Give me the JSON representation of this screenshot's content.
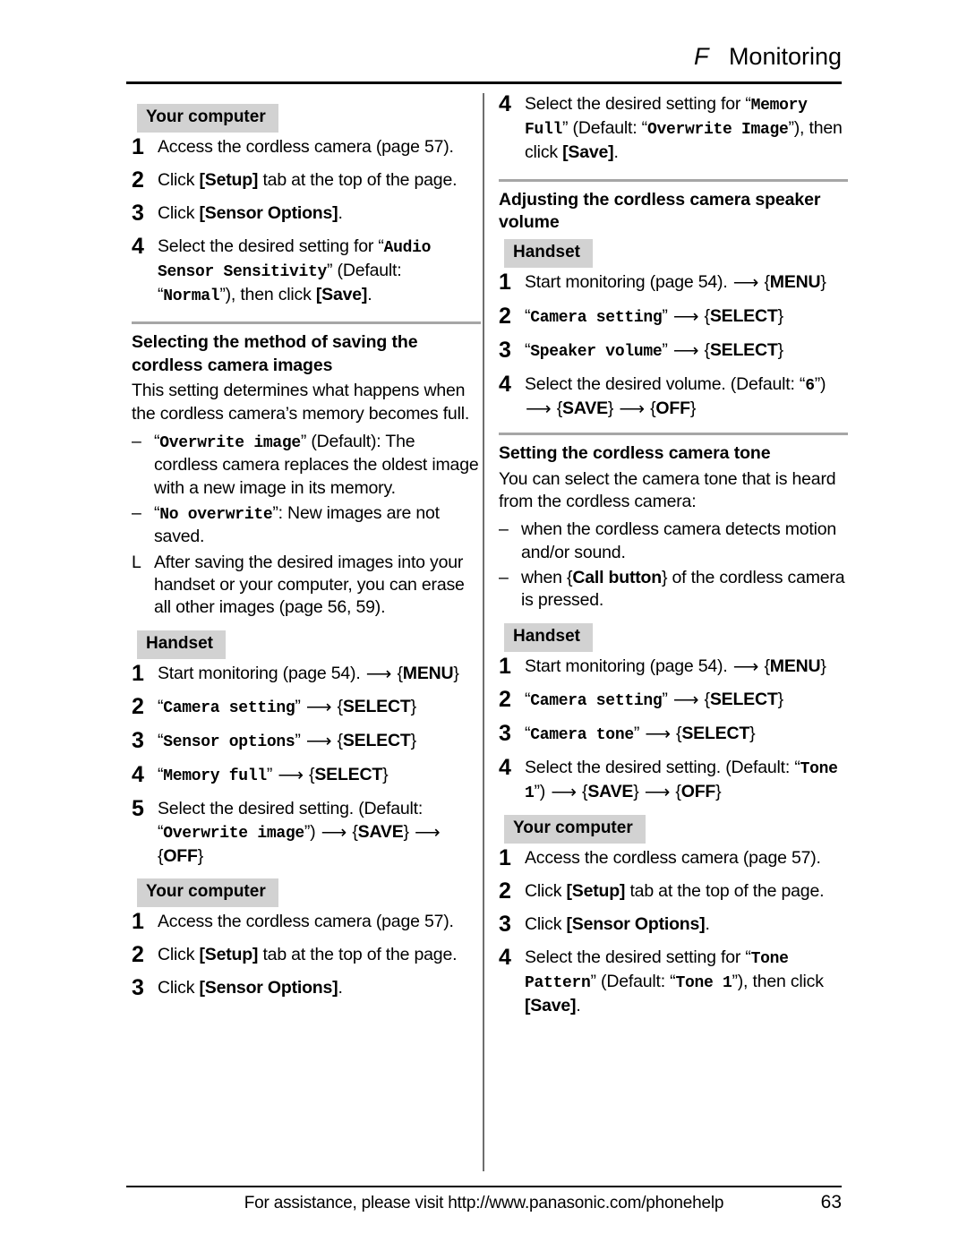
{
  "header": {
    "mark": "F",
    "title": "Monitoring"
  },
  "footer": {
    "assistance_text": "For assistance, please visit http://www.panasonic.com/phonehelp",
    "page_number": "63"
  },
  "labels": {
    "your_computer": "Your computer",
    "handset": "Handset"
  },
  "left_column": {
    "audio_sensor_computer_steps": [
      {
        "num": "1",
        "text": "Access the cordless camera (page 57)."
      },
      {
        "num": "2",
        "prefix": "Click ",
        "key": "[Setup]",
        "suffix": " tab at the top of the page."
      },
      {
        "num": "3",
        "prefix": "Click ",
        "key": "[Sensor Options]",
        "suffix": "."
      },
      {
        "num": "4",
        "parts": [
          {
            "t": "Select the desired setting for “",
            "s": "plain"
          },
          {
            "t": "Audio Sensor Sensitivity",
            "s": "mono"
          },
          {
            "t": "” (Default: “",
            "s": "plain"
          },
          {
            "t": "Normal",
            "s": "mono"
          },
          {
            "t": "”), then click ",
            "s": "plain"
          },
          {
            "t": "[Save]",
            "s": "bold"
          },
          {
            "t": ".",
            "s": "plain"
          }
        ]
      }
    ],
    "saving_section": {
      "title": "Selecting the method of saving the cordless camera images",
      "intro": "This setting determines what happens when the cordless camera’s memory becomes full.",
      "bullets": [
        {
          "marker": "–",
          "parts": [
            {
              "t": "“",
              "s": "plain"
            },
            {
              "t": "Overwrite image",
              "s": "mono"
            },
            {
              "t": "” (Default): The cordless camera replaces the oldest image with a new image in its memory.",
              "s": "plain"
            }
          ]
        },
        {
          "marker": "–",
          "parts": [
            {
              "t": "“",
              "s": "plain"
            },
            {
              "t": "No overwrite",
              "s": "mono"
            },
            {
              "t": "”: New images are not saved.",
              "s": "plain"
            }
          ]
        },
        {
          "marker": "L",
          "parts": [
            {
              "t": "After saving the desired images into your handset or your computer, you can erase all other images (page 56, 59).",
              "s": "plain"
            }
          ]
        }
      ],
      "handset_steps": [
        {
          "num": "1",
          "parts": [
            {
              "t": "Start monitoring (page 54). ",
              "s": "plain"
            },
            {
              "t": "⟶",
              "s": "arrow"
            },
            {
              "t": " {",
              "s": "brace"
            },
            {
              "t": "MENU",
              "s": "key"
            },
            {
              "t": "}",
              "s": "brace"
            }
          ]
        },
        {
          "num": "2",
          "parts": [
            {
              "t": "“",
              "s": "plain"
            },
            {
              "t": "Camera setting",
              "s": "mono"
            },
            {
              "t": "” ",
              "s": "plain"
            },
            {
              "t": "⟶",
              "s": "arrow"
            },
            {
              "t": " {",
              "s": "brace"
            },
            {
              "t": "SELECT",
              "s": "key"
            },
            {
              "t": "}",
              "s": "brace"
            }
          ]
        },
        {
          "num": "3",
          "parts": [
            {
              "t": "“",
              "s": "plain"
            },
            {
              "t": "Sensor options",
              "s": "mono"
            },
            {
              "t": "” ",
              "s": "plain"
            },
            {
              "t": "⟶",
              "s": "arrow"
            },
            {
              "t": " {",
              "s": "brace"
            },
            {
              "t": "SELECT",
              "s": "key"
            },
            {
              "t": "}",
              "s": "brace"
            }
          ]
        },
        {
          "num": "4",
          "parts": [
            {
              "t": "“",
              "s": "plain"
            },
            {
              "t": "Memory full",
              "s": "mono"
            },
            {
              "t": "” ",
              "s": "plain"
            },
            {
              "t": "⟶",
              "s": "arrow"
            },
            {
              "t": " {",
              "s": "brace"
            },
            {
              "t": "SELECT",
              "s": "key"
            },
            {
              "t": "}",
              "s": "brace"
            }
          ]
        },
        {
          "num": "5",
          "parts": [
            {
              "t": "Select the desired setting. (Default: “",
              "s": "plain"
            },
            {
              "t": "Overwrite image",
              "s": "mono"
            },
            {
              "t": "”) ",
              "s": "plain"
            },
            {
              "t": "⟶",
              "s": "arrow"
            },
            {
              "t": " {",
              "s": "brace"
            },
            {
              "t": "SAVE",
              "s": "key"
            },
            {
              "t": "} ",
              "s": "brace"
            },
            {
              "t": "⟶",
              "s": "arrow"
            },
            {
              "t": " {",
              "s": "brace"
            },
            {
              "t": "OFF",
              "s": "key"
            },
            {
              "t": "}",
              "s": "brace"
            }
          ]
        }
      ],
      "computer_steps": [
        {
          "num": "1",
          "text": "Access the cordless camera (page 57)."
        },
        {
          "num": "2",
          "prefix": "Click ",
          "key": "[Setup]",
          "suffix": " tab at the top of the page."
        },
        {
          "num": "3",
          "prefix": "Click ",
          "key": "[Sensor Options]",
          "suffix": "."
        }
      ]
    }
  },
  "right_column": {
    "memory_full_step": {
      "num": "4",
      "parts": [
        {
          "t": "Select the desired setting for “",
          "s": "plain"
        },
        {
          "t": "Memory Full",
          "s": "mono"
        },
        {
          "t": "” (Default: “",
          "s": "plain"
        },
        {
          "t": "Overwrite Image",
          "s": "mono"
        },
        {
          "t": "”), then click ",
          "s": "plain"
        },
        {
          "t": "[Save]",
          "s": "bold"
        },
        {
          "t": ".",
          "s": "plain"
        }
      ]
    },
    "speaker_section": {
      "title": "Adjusting the cordless camera speaker volume",
      "handset_steps": [
        {
          "num": "1",
          "parts": [
            {
              "t": "Start monitoring (page 54). ",
              "s": "plain"
            },
            {
              "t": "⟶",
              "s": "arrow"
            },
            {
              "t": " {",
              "s": "brace"
            },
            {
              "t": "MENU",
              "s": "key"
            },
            {
              "t": "}",
              "s": "brace"
            }
          ]
        },
        {
          "num": "2",
          "parts": [
            {
              "t": "“",
              "s": "plain"
            },
            {
              "t": "Camera setting",
              "s": "mono"
            },
            {
              "t": "” ",
              "s": "plain"
            },
            {
              "t": "⟶",
              "s": "arrow"
            },
            {
              "t": " {",
              "s": "brace"
            },
            {
              "t": "SELECT",
              "s": "key"
            },
            {
              "t": "}",
              "s": "brace"
            }
          ]
        },
        {
          "num": "3",
          "parts": [
            {
              "t": "“",
              "s": "plain"
            },
            {
              "t": "Speaker volume",
              "s": "mono"
            },
            {
              "t": "” ",
              "s": "plain"
            },
            {
              "t": "⟶",
              "s": "arrow"
            },
            {
              "t": " {",
              "s": "brace"
            },
            {
              "t": "SELECT",
              "s": "key"
            },
            {
              "t": "}",
              "s": "brace"
            }
          ]
        },
        {
          "num": "4",
          "parts": [
            {
              "t": "Select the desired volume. (Default: “",
              "s": "plain"
            },
            {
              "t": "6",
              "s": "mono"
            },
            {
              "t": "”) ",
              "s": "plain"
            },
            {
              "t": "⟶",
              "s": "arrow"
            },
            {
              "t": " {",
              "s": "brace"
            },
            {
              "t": "SAVE",
              "s": "key"
            },
            {
              "t": "} ",
              "s": "brace"
            },
            {
              "t": "⟶",
              "s": "arrow"
            },
            {
              "t": " {",
              "s": "brace"
            },
            {
              "t": "OFF",
              "s": "key"
            },
            {
              "t": "}",
              "s": "brace"
            }
          ]
        }
      ]
    },
    "tone_section": {
      "title": "Setting the cordless camera tone",
      "intro": "You can select the camera tone that is heard from the cordless camera:",
      "bullets": [
        {
          "marker": "–",
          "parts": [
            {
              "t": "when the cordless camera detects motion and/or sound.",
              "s": "plain"
            }
          ]
        },
        {
          "marker": "–",
          "parts": [
            {
              "t": "when {",
              "s": "plain"
            },
            {
              "t": "Call button",
              "s": "key"
            },
            {
              "t": "} of the cordless camera is pressed.",
              "s": "plain"
            }
          ]
        }
      ],
      "handset_steps": [
        {
          "num": "1",
          "parts": [
            {
              "t": "Start monitoring (page 54). ",
              "s": "plain"
            },
            {
              "t": "⟶",
              "s": "arrow"
            },
            {
              "t": " {",
              "s": "brace"
            },
            {
              "t": "MENU",
              "s": "key"
            },
            {
              "t": "}",
              "s": "brace"
            }
          ]
        },
        {
          "num": "2",
          "parts": [
            {
              "t": "“",
              "s": "plain"
            },
            {
              "t": "Camera setting",
              "s": "mono"
            },
            {
              "t": "” ",
              "s": "plain"
            },
            {
              "t": "⟶",
              "s": "arrow"
            },
            {
              "t": " {",
              "s": "brace"
            },
            {
              "t": "SELECT",
              "s": "key"
            },
            {
              "t": "}",
              "s": "brace"
            }
          ]
        },
        {
          "num": "3",
          "parts": [
            {
              "t": "“",
              "s": "plain"
            },
            {
              "t": "Camera tone",
              "s": "mono"
            },
            {
              "t": "” ",
              "s": "plain"
            },
            {
              "t": "⟶",
              "s": "arrow"
            },
            {
              "t": " {",
              "s": "brace"
            },
            {
              "t": "SELECT",
              "s": "key"
            },
            {
              "t": "}",
              "s": "brace"
            }
          ]
        },
        {
          "num": "4",
          "parts": [
            {
              "t": "Select the desired setting. (Default: “",
              "s": "plain"
            },
            {
              "t": "Tone 1",
              "s": "mono"
            },
            {
              "t": "”) ",
              "s": "plain"
            },
            {
              "t": "⟶",
              "s": "arrow"
            },
            {
              "t": " {",
              "s": "brace"
            },
            {
              "t": "SAVE",
              "s": "key"
            },
            {
              "t": "} ",
              "s": "brace"
            },
            {
              "t": "⟶",
              "s": "arrow"
            },
            {
              "t": " {",
              "s": "brace"
            },
            {
              "t": "OFF",
              "s": "key"
            },
            {
              "t": "}",
              "s": "brace"
            }
          ]
        }
      ],
      "computer_steps": [
        {
          "num": "1",
          "text": "Access the cordless camera (page 57)."
        },
        {
          "num": "2",
          "prefix": "Click ",
          "key": "[Setup]",
          "suffix": " tab at the top of the page."
        },
        {
          "num": "3",
          "prefix": "Click ",
          "key": "[Sensor Options]",
          "suffix": "."
        },
        {
          "num": "4",
          "parts": [
            {
              "t": "Select the desired setting for “",
              "s": "plain"
            },
            {
              "t": "Tone Pattern",
              "s": "mono"
            },
            {
              "t": "” (Default: “",
              "s": "plain"
            },
            {
              "t": "Tone 1",
              "s": "mono"
            },
            {
              "t": "”), then click ",
              "s": "plain"
            },
            {
              "t": "[Save]",
              "s": "bold"
            },
            {
              "t": ".",
              "s": "plain"
            }
          ]
        }
      ]
    }
  }
}
